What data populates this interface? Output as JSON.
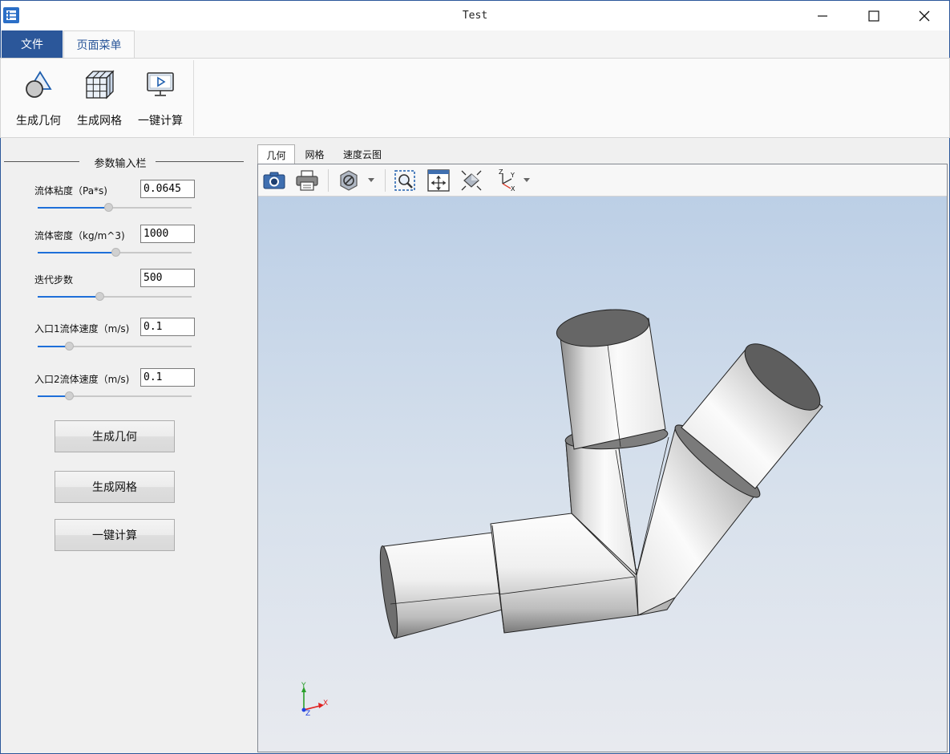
{
  "window": {
    "title": "Test"
  },
  "ribbon": {
    "tabs": [
      {
        "label": "文件"
      },
      {
        "label": "页面菜单"
      }
    ],
    "buttons": [
      {
        "label": "生成几何",
        "icon": "geometry-icon"
      },
      {
        "label": "生成网格",
        "icon": "mesh-icon"
      },
      {
        "label": "一键计算",
        "icon": "compute-icon"
      }
    ]
  },
  "params": {
    "group_title": "参数输入栏",
    "viscosity": {
      "label": "流体粘度（Pa*s)",
      "value": "0.0645",
      "slider": 0.46
    },
    "density": {
      "label": "流体密度（kg/m^3)",
      "value": "1000",
      "slider": 0.51
    },
    "iterations": {
      "label": "迭代步数",
      "value": "500",
      "slider": 0.4
    },
    "inlet1": {
      "label": "入口1流体速度（m/s)",
      "value": "0.1",
      "slider": 0.19
    },
    "inlet2": {
      "label": "入口2流体速度（m/s)",
      "value": "0.1",
      "slider": 0.19
    }
  },
  "actions": {
    "gen_geometry": "生成几何",
    "gen_mesh": "生成网格",
    "compute": "一键计算"
  },
  "viewer": {
    "tabs": [
      {
        "label": "几何"
      },
      {
        "label": "网格"
      },
      {
        "label": "速度云图"
      }
    ],
    "active_tab": "几何",
    "axes": {
      "y": "Y",
      "x": "X",
      "z": "Z"
    }
  },
  "colors": {
    "accent": "#2b579a",
    "slider_fill": "#1e6fd9"
  }
}
